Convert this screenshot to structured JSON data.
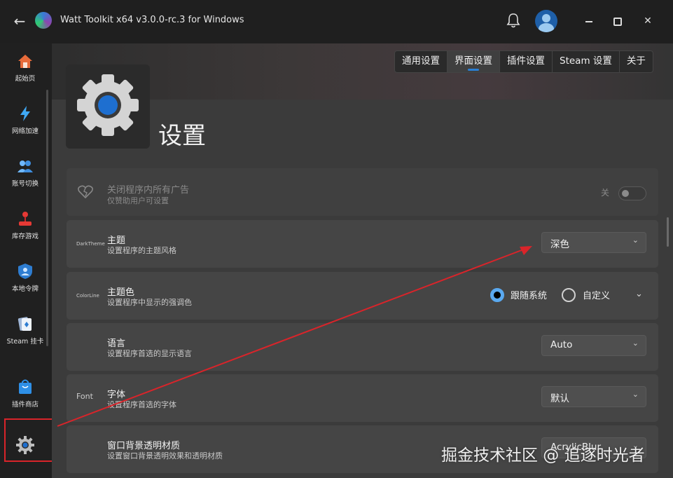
{
  "window": {
    "title": "Watt Toolkit x64 v3.0.0-rc.3 for Windows",
    "back_icon": "back-arrow-icon",
    "logo_icon": "app-logo-icon",
    "notification_icon": "bell-icon",
    "avatar_icon": "user-avatar-icon",
    "min_icon": "minimize-icon",
    "max_icon": "maximize-icon",
    "close_label": "✕"
  },
  "sidebar": {
    "items": [
      {
        "label": "起始页",
        "icon": "home-icon"
      },
      {
        "label": "网络加速",
        "icon": "lightning-icon"
      },
      {
        "label": "账号切换",
        "icon": "accounts-icon"
      },
      {
        "label": "库存游戏",
        "icon": "joystick-icon"
      },
      {
        "label": "本地令牌",
        "icon": "shield-user-icon"
      },
      {
        "label": "Steam 挂卡",
        "icon": "cards-icon"
      },
      {
        "label": "插件商店",
        "icon": "shopping-bag-icon"
      }
    ],
    "settings_icon": "gear-icon"
  },
  "tabs": [
    {
      "label": "通用设置",
      "active": false
    },
    {
      "label": "界面设置",
      "active": true
    },
    {
      "label": "插件设置",
      "active": false
    },
    {
      "label": "Steam 设置",
      "active": false
    },
    {
      "label": "关于",
      "active": false
    }
  ],
  "page": {
    "title": "设置",
    "icon": "settings-gear-icon"
  },
  "settings": {
    "ads": {
      "title": "关闭程序内所有广告",
      "subtitle": "仅赞助用户可设置",
      "toggle_label": "关",
      "icon": "broken-heart-icon",
      "enabled": false
    },
    "theme": {
      "lead": "DarkTheme",
      "title": "主题",
      "subtitle": "设置程序的主题风格",
      "value": "深色"
    },
    "accent": {
      "lead": "ColorLine",
      "title": "主题色",
      "subtitle": "设置程序中显示的强调色",
      "option1": "跟随系统",
      "option2": "自定义",
      "selected": "跟随系统"
    },
    "language": {
      "title": "语言",
      "subtitle": "设置程序首选的显示语言",
      "value": "Auto"
    },
    "font": {
      "lead": "Font",
      "title": "字体",
      "subtitle": "设置程序首选的字体",
      "value": "默认"
    },
    "backdrop": {
      "title": "窗口背景透明材质",
      "subtitle": "设置窗口背景透明效果和透明材质",
      "value": "AcrylicBlur"
    }
  },
  "watermark": "掘金技术社区 @ 追逐时光者",
  "colors": {
    "accent": "#2a7fd6",
    "annotation": "#d9242a",
    "background": "#3b3b3b"
  }
}
